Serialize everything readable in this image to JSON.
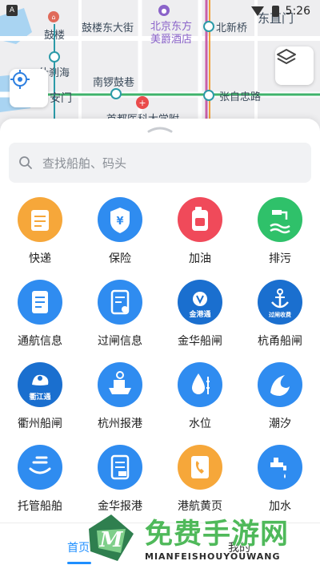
{
  "status_bar": {
    "time": "5:26",
    "left_badge": "A"
  },
  "map": {
    "labels": {
      "gulou_station": "鼓楼",
      "gulou_east_street": "鼓楼东大街",
      "beijing_east": "北京东方",
      "meijue_theater": "美爵酒店",
      "beixinqiao": "北新桥",
      "dongzhimen": "东直门",
      "shichahai": "什刹海",
      "nanluoguxiang": "南锣鼓巷",
      "andingmen": "安门",
      "zhangzizhong_road": "张自忠路",
      "hospital": "首都医科大学附"
    }
  },
  "search": {
    "placeholder": "查找船舶、码头"
  },
  "services": [
    {
      "label": "快递",
      "icon": "express-icon",
      "color": "#f6a73a"
    },
    {
      "label": "保险",
      "icon": "insurance-icon",
      "color": "#2f8cf0"
    },
    {
      "label": "加油",
      "icon": "fuel-icon",
      "color": "#f04a5a"
    },
    {
      "label": "排污",
      "icon": "sewage-icon",
      "color": "#2fc16a"
    },
    {
      "label": "通航信息",
      "icon": "navigation-info-icon",
      "color": "#2f8cf0"
    },
    {
      "label": "过闸信息",
      "icon": "lock-info-icon",
      "color": "#2f8cf0"
    },
    {
      "label": "金华船闸",
      "icon": "jinhua-lock-icon",
      "color": "#1a6fcf",
      "badge": "金港通"
    },
    {
      "label": "杭甬船闸",
      "icon": "hangyong-lock-icon",
      "color": "#1a6fcf",
      "badge": "过闸收费"
    },
    {
      "label": "衢州船闸",
      "icon": "quzhou-lock-icon",
      "color": "#1a6fcf",
      "badge": "衢江通"
    },
    {
      "label": "杭州报港",
      "icon": "hangzhou-port-icon",
      "color": "#2f8cf0"
    },
    {
      "label": "水位",
      "icon": "water-level-icon",
      "color": "#2f8cf0"
    },
    {
      "label": "潮汐",
      "icon": "tide-icon",
      "color": "#2f8cf0"
    },
    {
      "label": "托管船舶",
      "icon": "custody-ship-icon",
      "color": "#2f8cf0"
    },
    {
      "label": "金华报港",
      "icon": "jinhua-port-icon",
      "color": "#2f8cf0"
    },
    {
      "label": "港航黄页",
      "icon": "yellow-pages-icon",
      "color": "#f6a73a"
    },
    {
      "label": "加水",
      "icon": "water-supply-icon",
      "color": "#2f8cf0"
    }
  ],
  "nav": {
    "home": "首页",
    "mine": "我的",
    "active_color": "#1f8fff"
  },
  "watermark": {
    "title": "免费手游网",
    "subtitle": "MIANFEISHOUYOUWANG"
  }
}
